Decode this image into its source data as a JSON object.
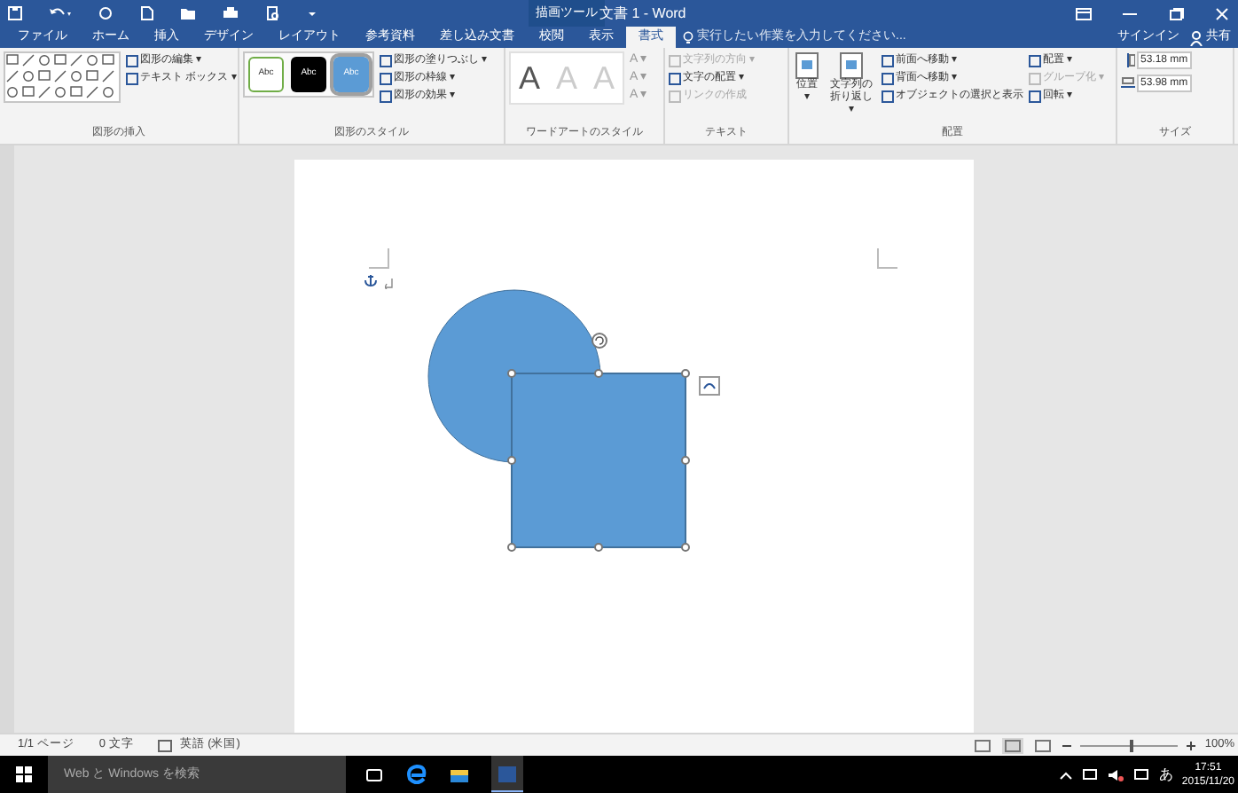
{
  "title_bar": {
    "contextual_label": "描画ツール",
    "title": "文書 1 - Word"
  },
  "tabs": [
    {
      "label": "ファイル",
      "selected": false
    },
    {
      "label": "ホーム",
      "selected": false
    },
    {
      "label": "挿入",
      "selected": false
    },
    {
      "label": "デザイン",
      "selected": false
    },
    {
      "label": "レイアウト",
      "selected": false
    },
    {
      "label": "参考資料",
      "selected": false
    },
    {
      "label": "差し込み文書",
      "selected": false
    },
    {
      "label": "校閲",
      "selected": false
    },
    {
      "label": "表示",
      "selected": false
    },
    {
      "label": "書式",
      "selected": true
    }
  ],
  "tell_me": "実行したい作業を入力してください...",
  "account": {
    "sign_in": "サインイン",
    "share": "共有"
  },
  "ribbon": {
    "insert_shapes": {
      "label": "図形の挿入",
      "commands": [
        {
          "label": "図形の編集 ▾",
          "disabled": false
        },
        {
          "label": "テキスト ボックス ▾",
          "disabled": false
        }
      ]
    },
    "shape_styles": {
      "label": "図形のスタイル",
      "swatches": [
        {
          "label": "Abc",
          "kind": "outline",
          "selected": false
        },
        {
          "label": "Abc",
          "kind": "dark",
          "selected": false
        },
        {
          "label": "Abc",
          "kind": "blue",
          "selected": true
        }
      ],
      "commands": [
        {
          "label": "図形の塗りつぶし ▾",
          "disabled": false
        },
        {
          "label": "図形の枠線 ▾",
          "disabled": false
        },
        {
          "label": "図形の効果 ▾",
          "disabled": false
        }
      ]
    },
    "wordart_styles": {
      "label": "ワードアートのスタイル",
      "letters": [
        "A",
        "A",
        "A"
      ],
      "small": [
        "A ▾",
        "A ▾",
        "A ▾"
      ]
    },
    "text": {
      "label": "テキスト",
      "commands": [
        {
          "label": "文字列の方向 ▾",
          "disabled": true
        },
        {
          "label": "文字の配置 ▾",
          "disabled": false
        },
        {
          "label": "リンクの作成",
          "disabled": true
        }
      ]
    },
    "arrange": {
      "label": "配置",
      "large": [
        "位置 ▾",
        "文字列の折り返し ▾"
      ],
      "commands": [
        {
          "label": "前面へ移動 ▾",
          "disabled": false
        },
        {
          "label": "背面へ移動 ▾",
          "disabled": false
        },
        {
          "label": "オブジェクトの選択と表示",
          "disabled": false
        }
      ],
      "commands2": [
        {
          "label": "配置 ▾",
          "disabled": false
        },
        {
          "label": "グループ化 ▾",
          "disabled": true
        },
        {
          "label": "回転 ▾",
          "disabled": false
        }
      ]
    },
    "size": {
      "label": "サイズ",
      "fields": [
        "53.18 mm",
        "53.98 mm"
      ]
    }
  },
  "status_bar": {
    "page": "1/1 ページ",
    "words": "0 文字",
    "language": "英語 (米国)",
    "zoom": {
      "level": 0.5,
      "reading": "100%"
    }
  },
  "taskbar": {
    "search_placeholder": "Web と Windows を検索",
    "ime": "あ",
    "time": "17:51",
    "date": "2015/11/20"
  }
}
